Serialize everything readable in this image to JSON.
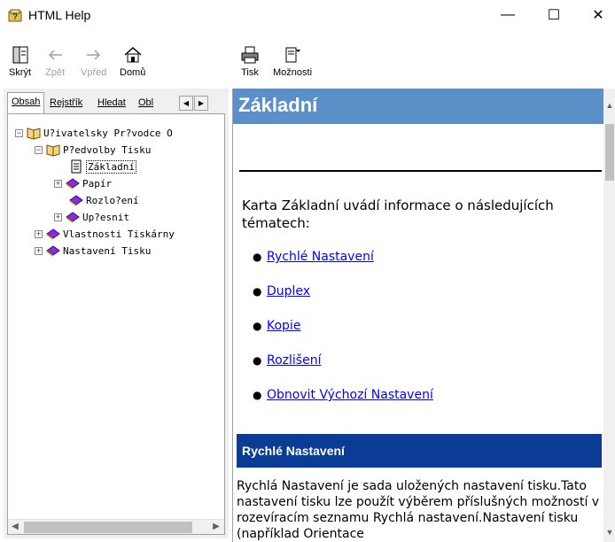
{
  "window": {
    "title": "HTML Help",
    "minimize_glyph": "—",
    "maximize_glyph": "☐",
    "close_glyph": "✕"
  },
  "toolbar": {
    "hide": "Skrýt",
    "back": "Zpět",
    "forward": "Vpřed",
    "home": "Domů",
    "print": "Tisk",
    "options": "Možnosti"
  },
  "tabs": {
    "contents": "Obsah",
    "index": "Rejstřík",
    "search": "Hledat",
    "favorites": "Obl"
  },
  "tree": {
    "root": "U?ivatelsky Pr?vodce O",
    "preferences": "P?edvolby Tisku",
    "basic": "Základní",
    "paper": "Papír",
    "layout": "Rozlo?ení",
    "advanced": "Up?esnit",
    "printer_properties": "Vlastnosti Tiskárny",
    "print_settings": "Nastavení Tisku"
  },
  "content": {
    "heading": "Základní",
    "intro": "Karta Základní uvádí informace o následujících tématech:",
    "links": [
      "Rychlé Nastavení",
      "Duplex",
      "Kopie",
      "Rozlišení",
      "Obnovit Výchozí Nastavení"
    ],
    "section_heading": "Rychlé Nastavení",
    "section_text": "Rychlá Nastavení je sada uložených nastavení tisku.Tato nastavení tisku lze použít výběrem příslušných možností v rozevíracím seznamu Rychlá nastavení.Nastavení tisku (například Orientace"
  },
  "colors": {
    "heading_bar": "#5b8fc8",
    "section_bar": "#0a3c96",
    "link": "#0000ff"
  }
}
